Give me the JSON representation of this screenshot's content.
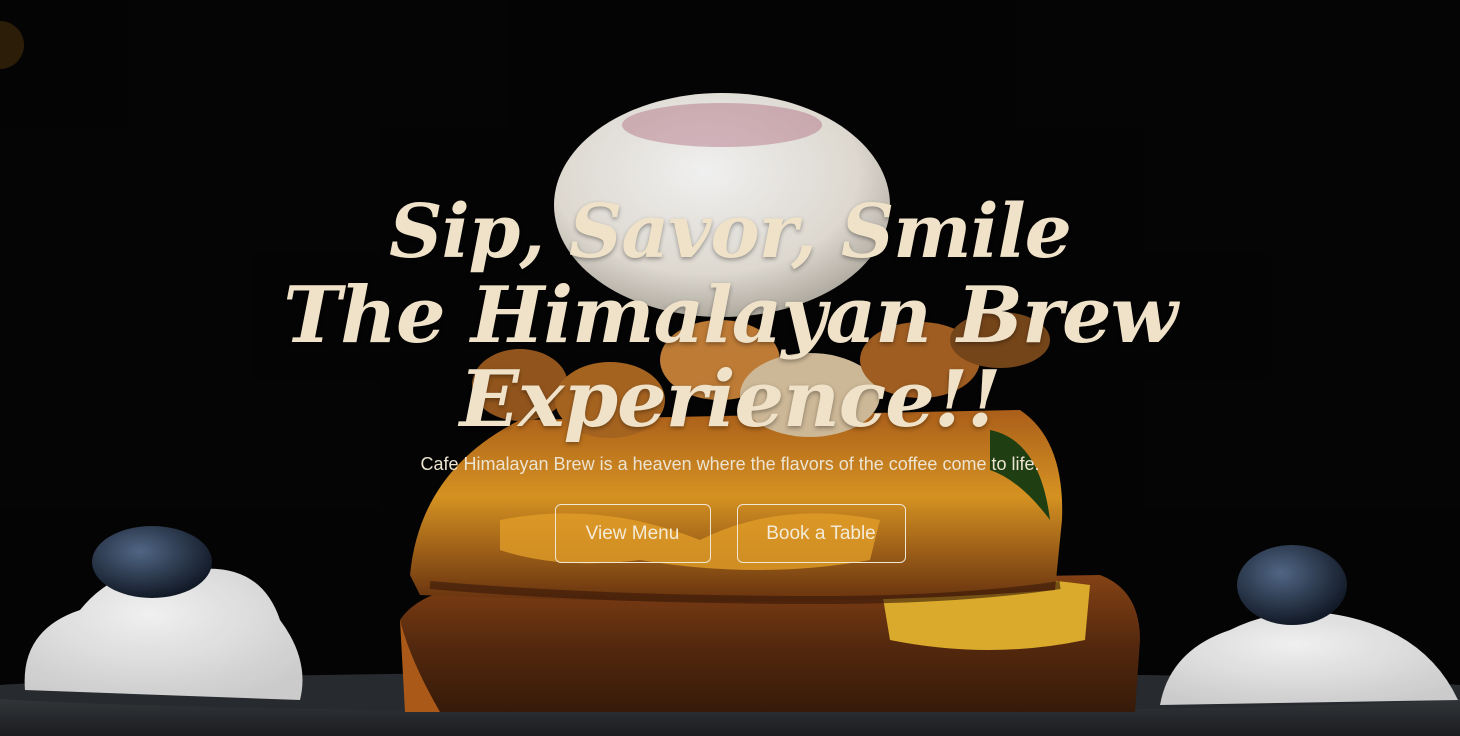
{
  "hero": {
    "headline_line1": "Sip, Savor, Smile",
    "headline_line2": "The Himalayan Brew Experience!!",
    "tagline": "Cafe Himalayan Brew is a heaven where the flavors of the coffee come to life.",
    "buttons": {
      "view_menu": "View Menu",
      "book_table": "Book a Table"
    }
  },
  "colors": {
    "background": "#050505",
    "headline": "#efe2c8",
    "button_border": "#efe6d4"
  }
}
